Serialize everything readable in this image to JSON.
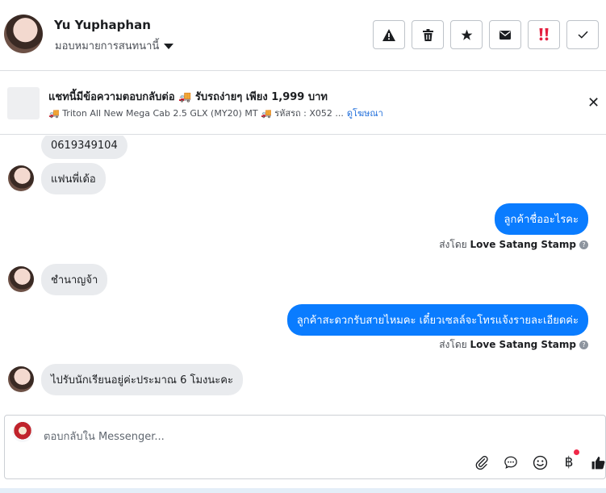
{
  "header": {
    "contact_name": "Yu Yuphaphan",
    "assign_label": "มอบหมายการสนทนานี้",
    "toolbar": [
      {
        "name": "spam-button",
        "icon": "warning-icon"
      },
      {
        "name": "delete-button",
        "icon": "trash-icon"
      },
      {
        "name": "star-button",
        "icon": "star-icon"
      },
      {
        "name": "mark-unread-button",
        "icon": "envelope-icon"
      },
      {
        "name": "follow-up-button",
        "icon": "double-exclamation-icon"
      },
      {
        "name": "mark-done-button",
        "icon": "check-icon"
      }
    ]
  },
  "ad_banner": {
    "title": "แชทนี้มีข้อความตอบกลับต่อ 🚚 รับรถง่ายๆ เพียง 1,999 บาท",
    "subtitle": "🚚 Triton All New Mega Cab 2.5 GLX (MY20) MT 🚚 รหัสรถ : X052 ...",
    "link": "ดูโฆษณา"
  },
  "messages": [
    {
      "side": "in",
      "text": "0619349104"
    },
    {
      "side": "in",
      "text": "แฟนพี่เด้อ"
    },
    {
      "side": "out",
      "text": "ลูกค้าชื่ออะไรคะ",
      "sent_by_prefix": "ส่งโดย",
      "sent_by": "Love Satang Stamp"
    },
    {
      "side": "in",
      "text": "ชำนาญจ้า"
    },
    {
      "side": "out",
      "text": "ลูกค้าสะดวกรับสายไหมคะ เดี๋ยวเซลล์จะโทรแจ้งรายละเอียดค่ะ",
      "sent_by_prefix": "ส่งโดย",
      "sent_by": "Love Satang Stamp"
    },
    {
      "side": "in",
      "text": "ไปรับนักเรียนอยู่ค่ะประมาณ 6 โมงนะคะ"
    }
  ],
  "composer": {
    "placeholder": "ตอบกลับใน Messenger..."
  }
}
